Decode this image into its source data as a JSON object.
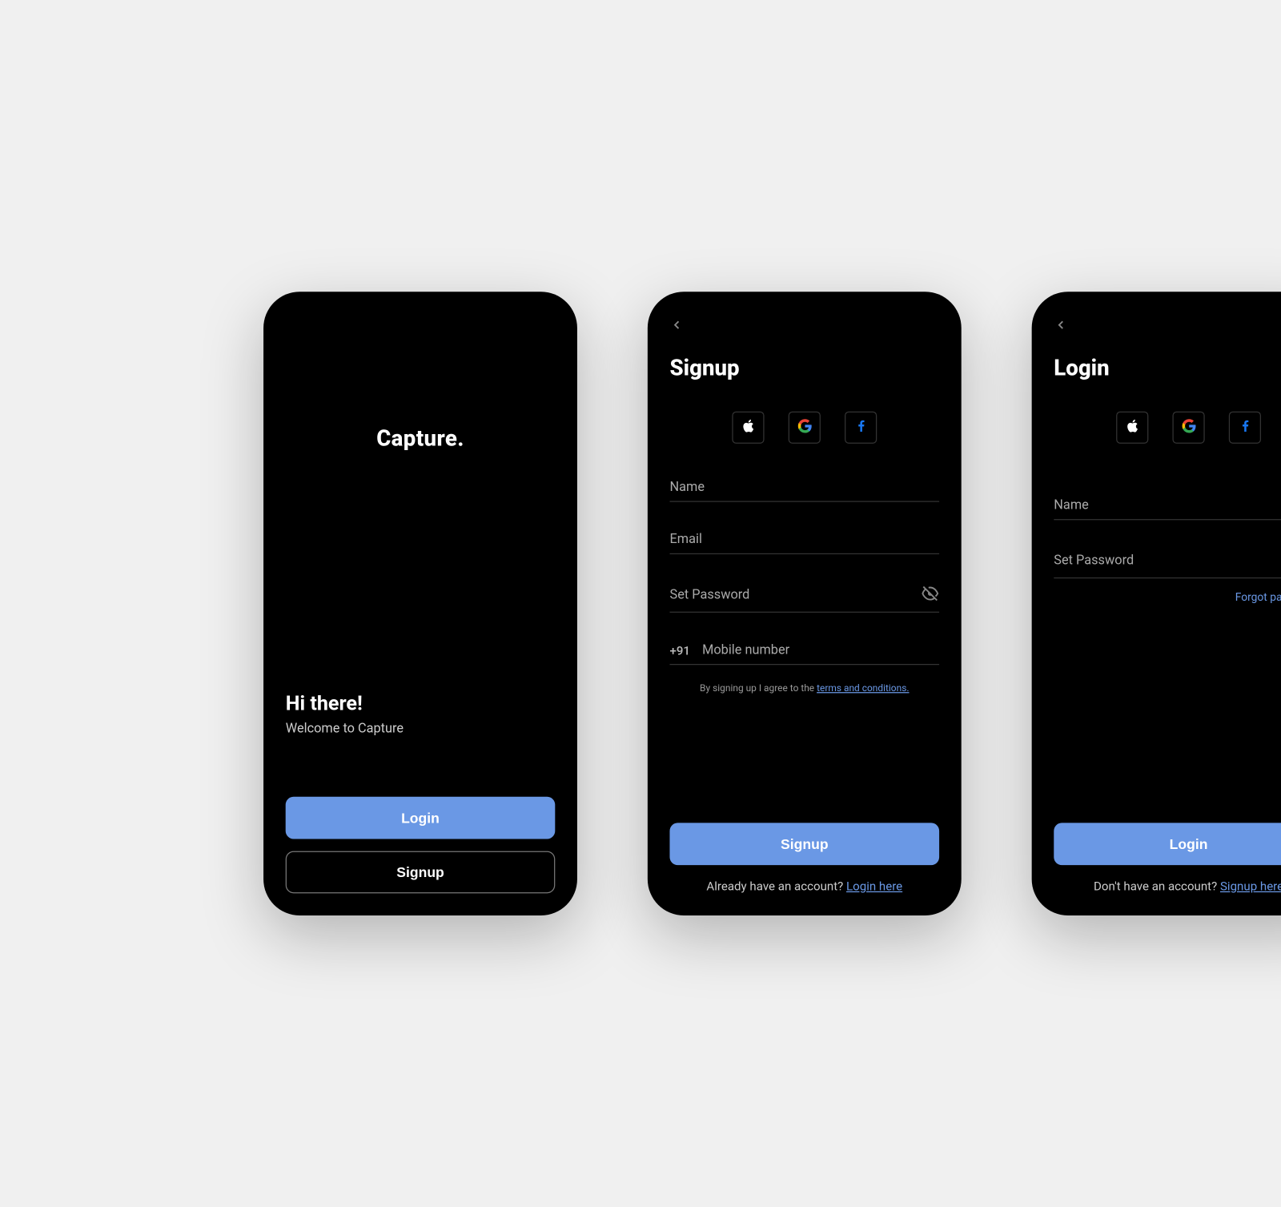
{
  "welcome": {
    "brand": "Capture.",
    "greeting": "Hi there!",
    "subgreeting": "Welcome to Capture",
    "login_label": "Login",
    "signup_label": "Signup"
  },
  "signup": {
    "title": "Signup",
    "fields": {
      "name": "Name",
      "email": "Email",
      "password": "Set Password",
      "country_code": "+91",
      "mobile": "Mobile number"
    },
    "terms_prefix": "By signing up I agree to the ",
    "terms_link": "terms and conditions.",
    "submit_label": "Signup",
    "switch_prefix": "Already have an account? ",
    "switch_link": "Login here"
  },
  "login": {
    "title": "Login",
    "fields": {
      "name": "Name",
      "password": "Set Password"
    },
    "forgot": "Forgot password?",
    "submit_label": "Login",
    "switch_prefix": "Don't have an account? ",
    "switch_link": "Signup here"
  },
  "social": {
    "apple": "apple-icon",
    "google": "google-icon",
    "facebook": "facebook-icon"
  },
  "colors": {
    "accent": "#6a98e5",
    "bg": "#000000"
  }
}
